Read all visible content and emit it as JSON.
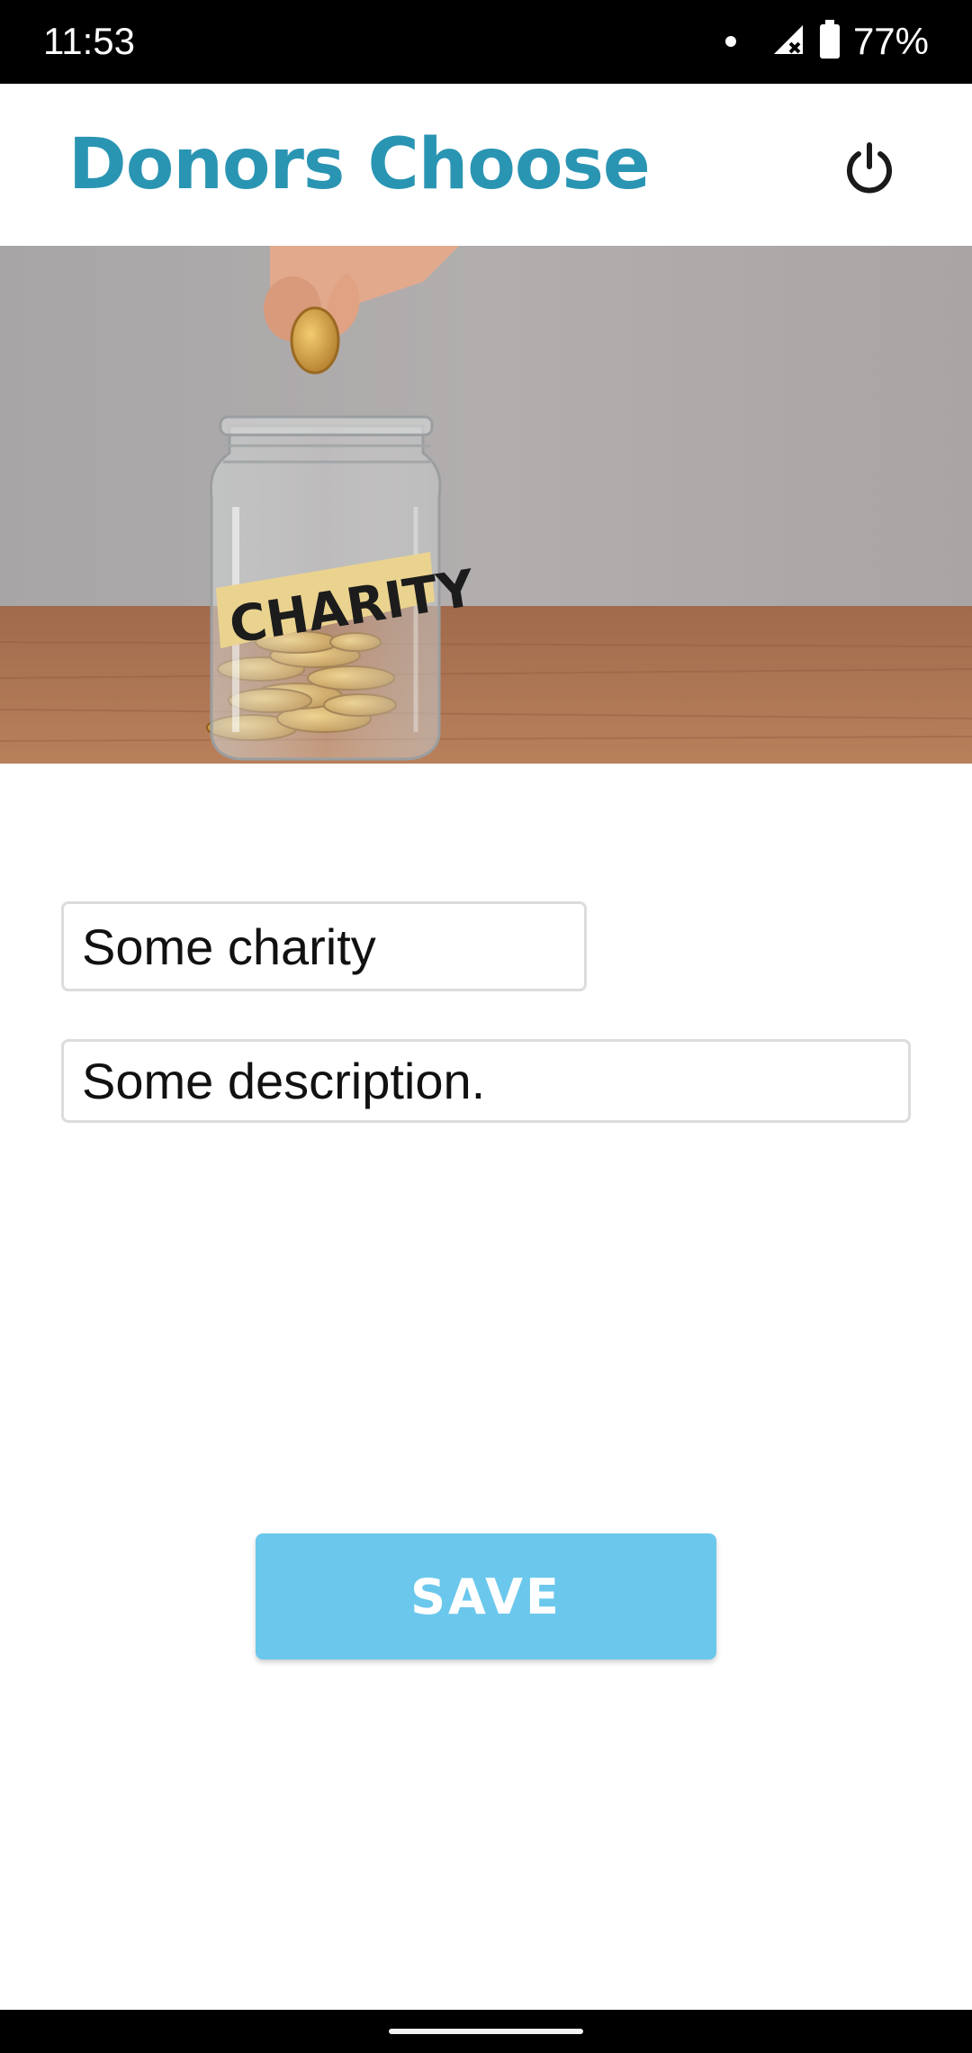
{
  "status_bar": {
    "time": "11:53",
    "battery_percent": "77%",
    "icons": [
      "notification-dot-icon",
      "signal-icon",
      "battery-icon"
    ]
  },
  "app_bar": {
    "title": "Donors Choose",
    "title_color": "#2a95b3",
    "power_icon": "power-icon"
  },
  "hero": {
    "jar_label": "CHARITY"
  },
  "form": {
    "name_value": "Some charity",
    "description_value": "Some description."
  },
  "save_button": {
    "label": "SAVE",
    "color": "#6bc8ec"
  }
}
